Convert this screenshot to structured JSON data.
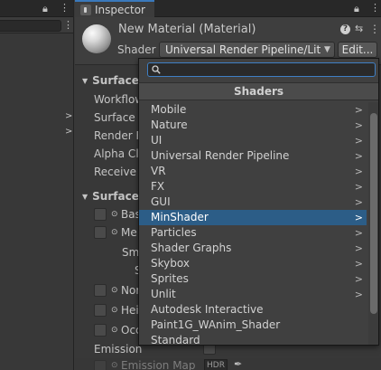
{
  "inspector": {
    "tab_label": "Inspector",
    "material_title": "New Material (Material)",
    "shader_label": "Shader",
    "shader_value": "Universal Render Pipeline/Lit",
    "edit_label": "Edit...",
    "icons": {
      "lock": "lock-icon",
      "menu": "kebab-menu-icon",
      "help": "help-icon",
      "preset": "preset-sliders-icon"
    }
  },
  "background": {
    "section1": "Surface",
    "rows": [
      "Workflow",
      "Surface",
      "Render F",
      "Alpha Cl",
      "Receive"
    ],
    "section2": "Surface",
    "inputs": [
      "Bas",
      "Me",
      "Sm",
      "S",
      "Nor",
      "Hei",
      "Occ"
    ],
    "emission_label": "Emission",
    "emission_map_label": "Emission Map",
    "hdr_label": "HDR"
  },
  "popup": {
    "search_value": "",
    "header": "Shaders",
    "items": [
      {
        "label": "Mobile",
        "submenu": true
      },
      {
        "label": "Nature",
        "submenu": true
      },
      {
        "label": "UI",
        "submenu": true
      },
      {
        "label": "Universal Render Pipeline",
        "submenu": true
      },
      {
        "label": "VR",
        "submenu": true
      },
      {
        "label": "FX",
        "submenu": true
      },
      {
        "label": "GUI",
        "submenu": true
      },
      {
        "label": "MinShader",
        "submenu": true,
        "selected": true
      },
      {
        "label": "Particles",
        "submenu": true
      },
      {
        "label": "Shader Graphs",
        "submenu": true
      },
      {
        "label": "Skybox",
        "submenu": true
      },
      {
        "label": "Sprites",
        "submenu": true
      },
      {
        "label": "Unlit",
        "submenu": true
      },
      {
        "label": "Autodesk Interactive",
        "submenu": false
      },
      {
        "label": "Paint1G_WAnim_Shader",
        "submenu": false
      },
      {
        "label": "Standard",
        "submenu": false
      }
    ],
    "chevron_glyph": ">"
  },
  "colors": {
    "selection": "#2c5d87",
    "accent": "#3a79bb"
  }
}
